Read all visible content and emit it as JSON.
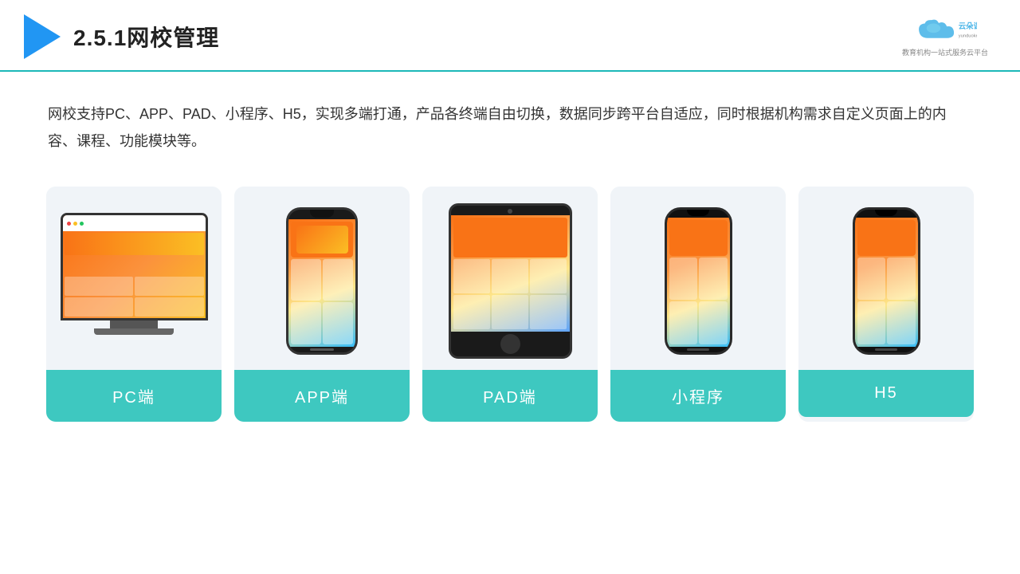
{
  "header": {
    "title": "2.5.1网校管理",
    "logo_name": "云朵课堂",
    "logo_url": "yunduoketang.com",
    "logo_tagline": "教育机构一站式服务云平台"
  },
  "description": {
    "text": "网校支持PC、APP、PAD、小程序、H5，实现多端打通，产品各终端自由切换，数据同步跨平台自适应，同时根据机构需求自定义页面上的内容、课程、功能模块等。"
  },
  "cards": [
    {
      "label": "PC端"
    },
    {
      "label": "APP端"
    },
    {
      "label": "PAD端"
    },
    {
      "label": "小程序"
    },
    {
      "label": "H5"
    }
  ]
}
